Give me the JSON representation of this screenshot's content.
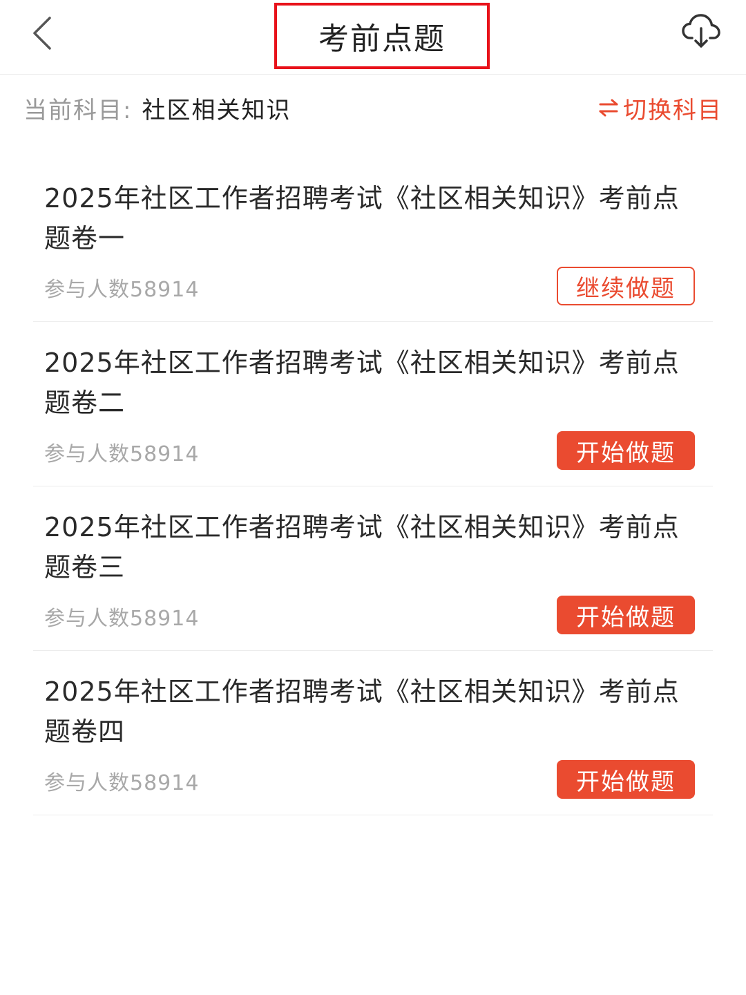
{
  "header": {
    "title": "考前点题",
    "back_icon": "chevron-left-icon",
    "download_icon": "cloud-download-icon"
  },
  "subject": {
    "label": "当前科目:",
    "value": "社区相关知识",
    "switch_label": "切换科目",
    "switch_icon": "swap-arrows-icon"
  },
  "colors": {
    "accent": "#ea4b30",
    "highlight_box": "#e8121a"
  },
  "papers": [
    {
      "title": "2025年社区工作者招聘考试《社区相关知识》考前点题卷一",
      "participants": "参与人数58914",
      "action": "继续做题",
      "style": "outline"
    },
    {
      "title": "2025年社区工作者招聘考试《社区相关知识》考前点题卷二",
      "participants": "参与人数58914",
      "action": "开始做题",
      "style": "filled"
    },
    {
      "title": "2025年社区工作者招聘考试《社区相关知识》考前点题卷三",
      "participants": "参与人数58914",
      "action": "开始做题",
      "style": "filled"
    },
    {
      "title": "2025年社区工作者招聘考试《社区相关知识》考前点题卷四",
      "participants": "参与人数58914",
      "action": "开始做题",
      "style": "filled"
    }
  ]
}
